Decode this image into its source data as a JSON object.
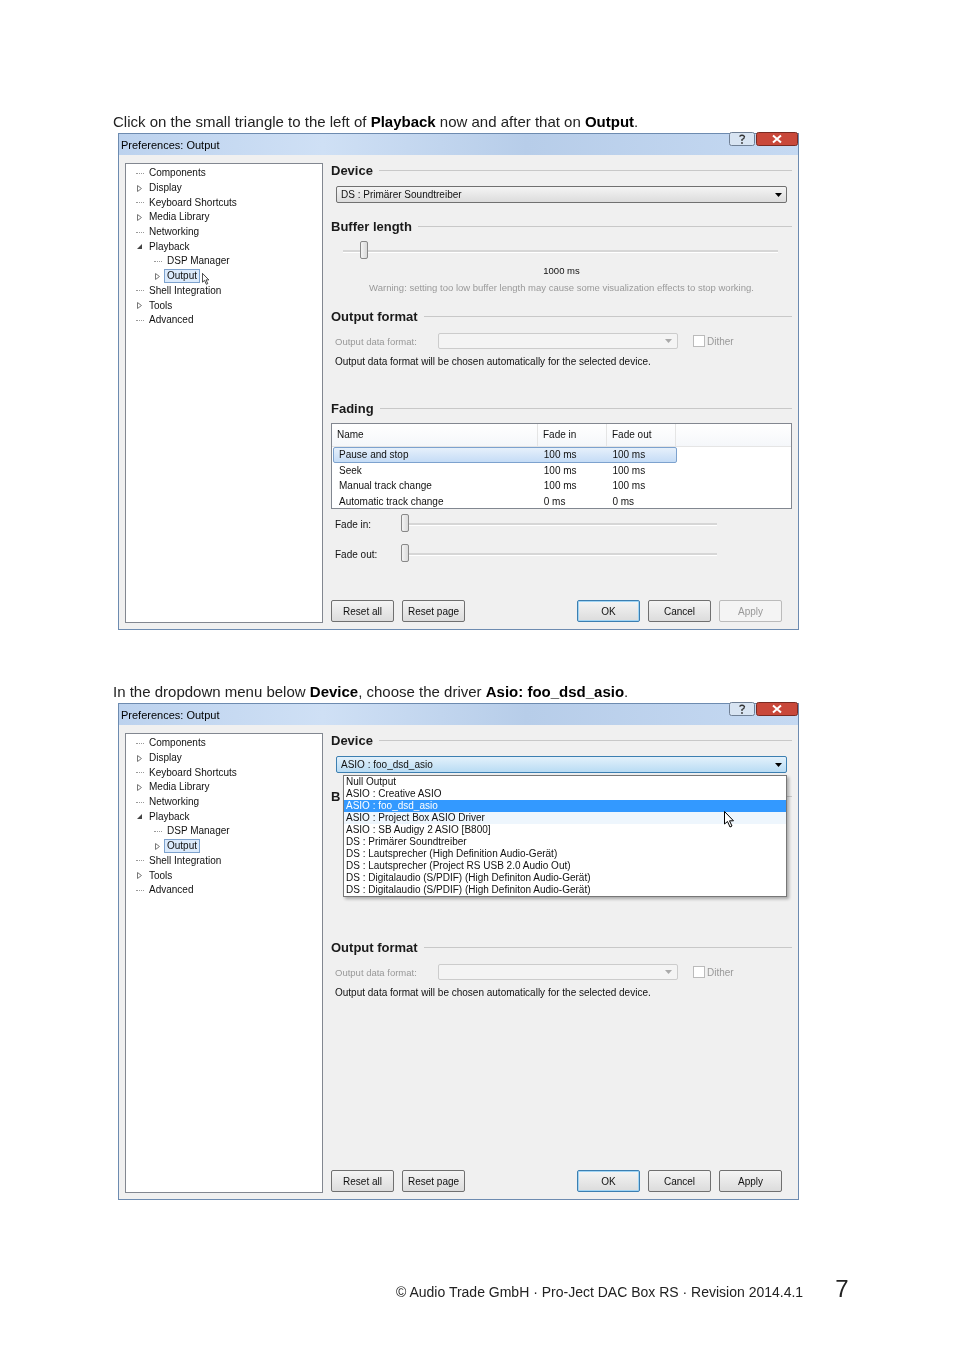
{
  "steps": [
    {
      "instruction": "Click on the small triangle to the left of **Playback** now and after that on **Output**.",
      "window": {
        "title": "Preferences: Output",
        "tree": [
          {
            "label": "Components",
            "selected": false,
            "hover": false
          },
          {
            "label": "Display",
            "expanded": false,
            "selected": false,
            "hover": false
          },
          {
            "label": "Keyboard Shortcuts",
            "selected": false,
            "hover": false
          },
          {
            "label": "Media Library",
            "expanded": false,
            "selected": false,
            "hover": false
          },
          {
            "label": "Networking",
            "selected": false,
            "hover": false
          },
          {
            "label": "Playback",
            "expanded": true,
            "selected": false,
            "hover": false,
            "children": [
              {
                "label": "DSP Manager",
                "selected": false,
                "hover": false
              },
              {
                "label": "Output",
                "expanded": false,
                "selected": true,
                "hover": true
              }
            ]
          },
          {
            "label": "Shell Integration",
            "selected": false,
            "hover": false
          },
          {
            "label": "Tools",
            "expanded": false,
            "selected": false,
            "hover": false
          },
          {
            "label": "Advanced",
            "selected": false,
            "hover": false
          }
        ],
        "sections": [
          {
            "kind": "device",
            "heading": "Device",
            "value": "DS : Primärer Soundtreiber",
            "open": false
          },
          {
            "kind": "buffer",
            "heading": "Buffer length",
            "level": 0.04,
            "reading": "1000 ms",
            "warning": "Warning: setting too low buffer length may cause some visualization effects to stop working."
          },
          {
            "kind": "output_format",
            "heading": "Output format",
            "label": "Output data format:",
            "dither": "Dither",
            "dither_checked": false,
            "note": "Output data format will be chosen automatically for the selected device."
          },
          {
            "kind": "fading",
            "heading": "Fading",
            "columns": [
              "Name",
              "Fade in",
              "Fade out"
            ],
            "rows": [
              {
                "cells": [
                  "Pause and stop",
                  "100 ms",
                  "100 ms"
                ],
                "selected": true
              },
              {
                "cells": [
                  "Seek",
                  "100 ms",
                  "100 ms"
                ],
                "selected": false
              },
              {
                "cells": [
                  "Manual track change",
                  "100 ms",
                  "100 ms"
                ],
                "selected": false
              },
              {
                "cells": [
                  "Automatic track change",
                  "0 ms",
                  "0 ms"
                ],
                "selected": false
              }
            ],
            "sliders": [
              {
                "label": "Fade in:",
                "level": 0
              },
              {
                "label": "Fade out:",
                "level": 0
              }
            ]
          }
        ],
        "buttons": [
          {
            "label": "Reset all",
            "disabled": false,
            "default": false
          },
          {
            "label": "Reset page",
            "disabled": false,
            "default": false
          },
          {
            "label": "OK",
            "disabled": false,
            "default": true
          },
          {
            "label": "Cancel",
            "disabled": false,
            "default": false
          },
          {
            "label": "Apply",
            "disabled": true,
            "default": false
          }
        ]
      }
    },
    {
      "instruction": "In the dropdown menu below **Device**, choose the driver **Asio: foo_dsd_asio**.",
      "window": {
        "title": "Preferences: Output",
        "tree": [
          {
            "label": "Components",
            "selected": false
          },
          {
            "label": "Display",
            "expanded": false,
            "selected": false
          },
          {
            "label": "Keyboard Shortcuts",
            "selected": false
          },
          {
            "label": "Media Library",
            "expanded": false,
            "selected": false
          },
          {
            "label": "Networking",
            "selected": false
          },
          {
            "label": "Playback",
            "expanded": true,
            "selected": false,
            "children": [
              {
                "label": "DSP Manager",
                "selected": false
              },
              {
                "label": "Output",
                "expanded": false,
                "selected": true
              }
            ]
          },
          {
            "label": "Shell Integration",
            "selected": false
          },
          {
            "label": "Tools",
            "expanded": false,
            "selected": false
          },
          {
            "label": "Advanced",
            "selected": false
          }
        ],
        "sections": [
          {
            "kind": "device",
            "heading": "Device",
            "value": "ASIO : foo_dsd_asio",
            "open": true,
            "options": [
              {
                "label": "Null Output",
                "selected": false,
                "hover": false
              },
              {
                "label": "ASIO : Creative ASIO",
                "selected": false,
                "hover": false
              },
              {
                "label": "ASIO : foo_dsd_asio",
                "selected": true,
                "hover": false
              },
              {
                "label": "ASIO : Project Box ASIO Driver",
                "selected": false,
                "hover": true
              },
              {
                "label": "ASIO : SB Audigy 2 ASIO [B800]",
                "selected": false,
                "hover": false
              },
              {
                "label": "DS : Primärer Soundtreiber",
                "selected": false,
                "hover": false
              },
              {
                "label": "DS : Lautsprecher (High Definition Audio-Gerät)",
                "selected": false,
                "hover": false
              },
              {
                "label": "DS : Lautsprecher (Project RS USB 2.0 Audio Out)",
                "selected": false,
                "hover": false
              },
              {
                "label": "DS : Digitalaudio (S/PDIF) (High Definiton Audio-Gerät)",
                "selected": false,
                "hover": false
              },
              {
                "label": "DS : Digitalaudio (S/PDIF) (High Definiton Audio-Gerät)",
                "selected": false,
                "hover": false
              }
            ]
          },
          {
            "kind": "buffer",
            "heading": "B"
          },
          {
            "kind": "output_format",
            "heading": "Output format",
            "label": "Output data format:",
            "dither": "Dither",
            "dither_checked": false,
            "note": "Output data format will be chosen automatically for the selected device."
          }
        ],
        "buttons": [
          {
            "label": "Reset all",
            "disabled": false,
            "default": false
          },
          {
            "label": "Reset page",
            "disabled": false,
            "default": false
          },
          {
            "label": "OK",
            "disabled": false,
            "default": true
          },
          {
            "label": "Cancel",
            "disabled": false,
            "default": false
          },
          {
            "label": "Apply",
            "disabled": false,
            "default": false
          }
        ]
      }
    }
  ],
  "footer": "© Audio Trade GmbH · Pro-Ject DAC Box RS · Revision 2014.4.1",
  "page_number": "7"
}
